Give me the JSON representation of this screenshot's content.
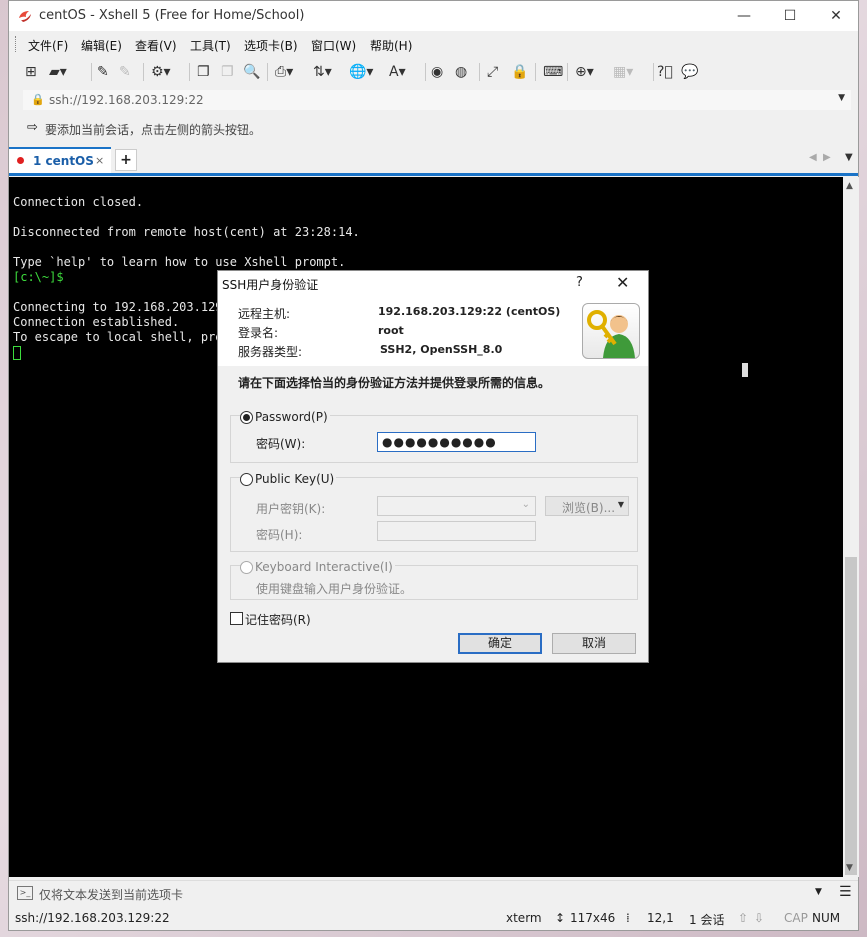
{
  "window": {
    "title": "centOS - Xshell 5 (Free for Home/School)",
    "minimize": "—",
    "maximize": "☐",
    "close": "✕"
  },
  "menu": [
    "文件(F)",
    "编辑(E)",
    "查看(V)",
    "工具(T)",
    "选项卡(B)",
    "窗口(W)",
    "帮助(H)"
  ],
  "address": {
    "url": "ssh://192.168.203.129:22"
  },
  "hint": {
    "text": "要添加当前会话，点击左侧的箭头按钮。"
  },
  "tabs": {
    "active_label": "1 centOS",
    "close": "×",
    "new": "+"
  },
  "terminal": {
    "lines": [
      "Connection closed.",
      "",
      "Disconnected from remote host(cent) at 23:28:14.",
      "",
      "Type `help' to learn how to use Xshell prompt."
    ],
    "prompt": "[c:\\~]$",
    "lines2": [
      "",
      "Connecting to 192.168.203.129",
      "Connection established.",
      "To escape to local shell, pre"
    ]
  },
  "dialog": {
    "title": "SSH用户身份验证",
    "help": "?",
    "close": "✕",
    "remote_host_label": "远程主机:",
    "remote_host_value": "192.168.203.129:22 (centOS)",
    "login_label": "登录名:",
    "login_value": "root",
    "server_type_label": "服务器类型:",
    "server_type_value": "SSH2, OpenSSH_8.0",
    "instruction": "请在下面选择恰当的身份验证方法并提供登录所需的信息。",
    "password_option": "Password(P)",
    "password_field_label": "密码(W):",
    "password_value": "●●●●●●●●●●",
    "publickey_option": "Public Key(U)",
    "user_key_label": "用户密钥(K):",
    "browse_label": "浏览(B)...",
    "passphrase_label": "密码(H):",
    "keyboard_option": "Keyboard Interactive(I)",
    "keyboard_desc": "使用键盘输入用户身份验证。",
    "remember_label": "记住密码(R)",
    "ok_label": "确定",
    "cancel_label": "取消"
  },
  "sendbar": {
    "text": "仅将文本发送到当前选项卡"
  },
  "status": {
    "url": "ssh://192.168.203.129:22",
    "term": "xterm",
    "size": "117x46",
    "pos": "12,1",
    "sessions": "1 会话",
    "cap": "CAP",
    "num": "NUM"
  }
}
